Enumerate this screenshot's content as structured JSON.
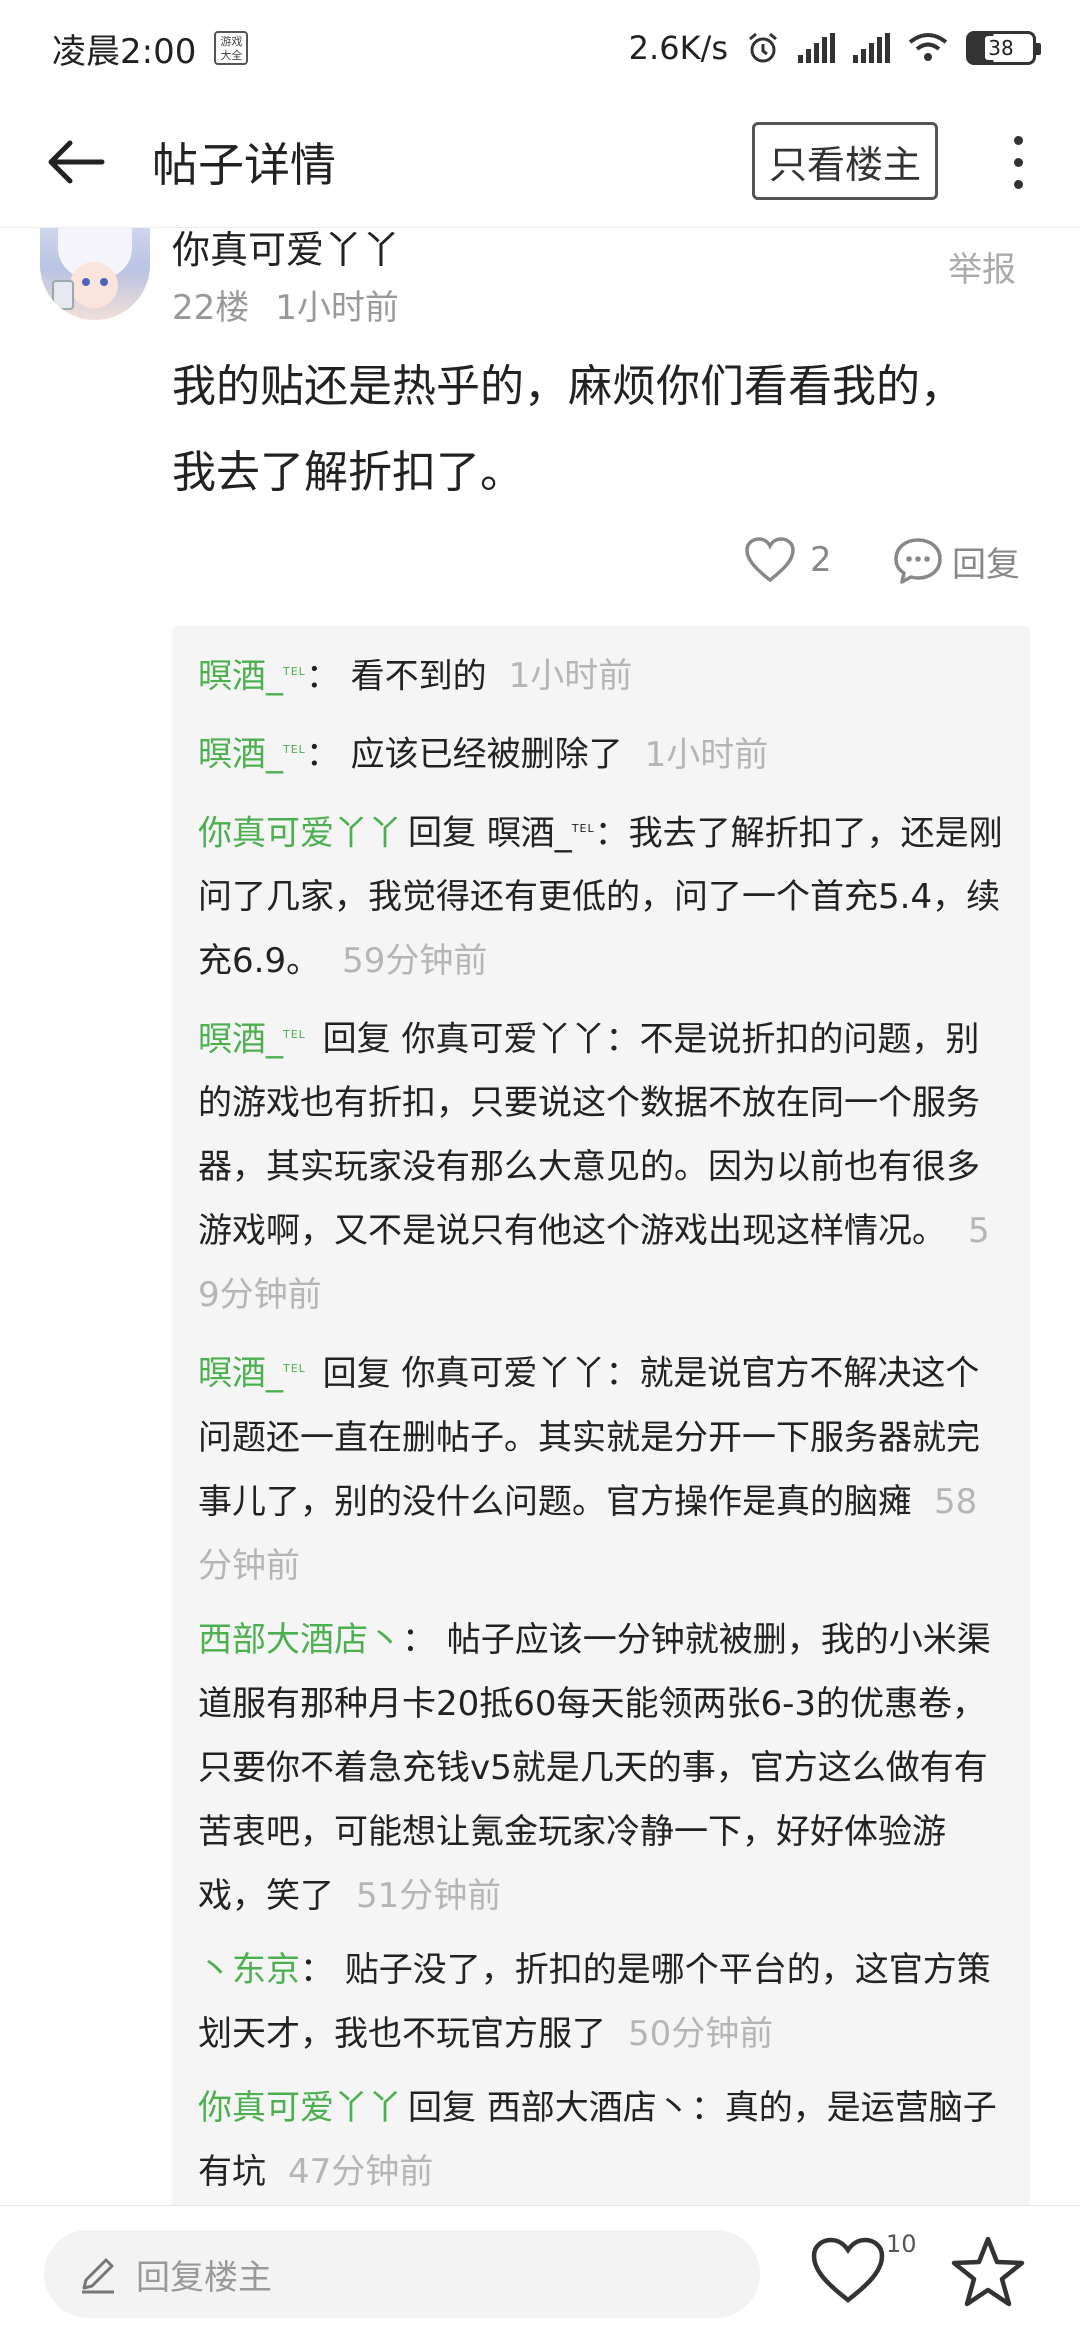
{
  "status_bar": {
    "time": "凌晨2:00",
    "app_badge": "游戏\n大全",
    "net_speed": "2.6K/s",
    "battery": "38"
  },
  "header": {
    "title": "帖子详情",
    "op_only_label": "只看楼主"
  },
  "floor": {
    "username": "你真可爱丫丫",
    "floor_no": "22楼",
    "time": "1小时前",
    "report_label": "举报",
    "content_line1": "我的贴还是热乎的，麻烦你们看看我的，",
    "content_line2": "我去了解折扣了。",
    "like_count": "2",
    "reply_label": "回复"
  },
  "replies": [
    {
      "name": "暝酒_",
      "tag": "TEL",
      "sep": "：",
      "text": " 看不到的",
      "time": "1小时前"
    },
    {
      "name": "暝酒_",
      "tag": "TEL",
      "sep": "：",
      "text": " 应该已经被删除了",
      "time": "1小时前"
    },
    {
      "name": "你真可爱丫丫",
      "verb": "回复",
      "target": "暝酒_",
      "target_tag": "TEL",
      "sep": "：",
      "text": "我去了解折扣了，还是刚问了几家，我觉得还有更低的，问了一个首充5.4，续充6.9。",
      "time": "59分钟前"
    },
    {
      "name": "暝酒_",
      "tag": "TEL",
      "verb": "回复",
      "target": "你真可爱丫丫",
      "sep": "：",
      "text": "不是说折扣的问题，别的游戏也有折扣，只要说这个数据不放在同一个服务器，其实玩家没有那么大意见的。因为以前也有很多游戏啊，又不是说只有他这个游戏出现这样情况。",
      "time": "59分钟前"
    },
    {
      "name": "暝酒_",
      "tag": "TEL",
      "verb": "回复",
      "target": "你真可爱丫丫",
      "sep": "：",
      "text": "就是说官方不解决这个问题还一直在删帖子。其实就是分开一下服务器就完事儿了，别的没什么问题。官方操作是真的脑瘫",
      "time": "58分钟前"
    },
    {
      "name": "西部大酒店丶",
      "sep": "：",
      "text": " 帖子应该一分钟就被删，我的小米渠道服有那种月卡20抵60每天能领两张6-3的优惠卷，只要你不着急充钱v5就是几天的事，官方这么做有有苦衷吧，可能想让氪金玩家冷静一下，好好体验游戏，笑了",
      "time": "51分钟前"
    },
    {
      "name": "丶东京",
      "sep": "：",
      "text": " 贴子没了，折扣的是哪个平台的，这官方策划天才，我也不玩官方服了",
      "time": "50分钟前"
    },
    {
      "name": "你真可爱丫丫",
      "verb": "回复",
      "target": "西部大酒店丶",
      "sep": "：",
      "text": "真的，是运营脑子有坑",
      "time": "47分钟前"
    }
  ],
  "bottom_bar": {
    "reply_placeholder": "回复楼主",
    "like_count": "10"
  },
  "colors": {
    "username_green": "#4caf50",
    "time_gray": "#b5b5b5"
  }
}
